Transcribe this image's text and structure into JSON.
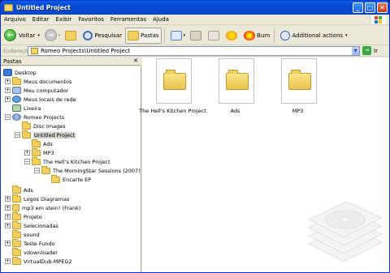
{
  "window": {
    "title": "Untitled Project"
  },
  "menu": [
    "Arquivo",
    "Editar",
    "Exibir",
    "Favoritos",
    "Ferramentas",
    "Ajuda"
  ],
  "toolbar": {
    "back": "Voltar",
    "search": "Pesquisar",
    "folders": "Pastas",
    "burn": "Burn",
    "additional": "Additional actions"
  },
  "address": {
    "label": "Endereço",
    "value": "Romeo Projects\\Untitled Project",
    "go": "Ir"
  },
  "pane": {
    "title": "Pastas"
  },
  "tree": [
    {
      "label": "Desktop"
    },
    {
      "label": "Meus documentos"
    },
    {
      "label": "Meu computador"
    },
    {
      "label": "Meus locais de rede"
    },
    {
      "label": "Lixeira"
    },
    {
      "label": "Romeo Projects"
    },
    {
      "label": "Disc Images"
    },
    {
      "label": "Untitled Project"
    },
    {
      "label": "Ads"
    },
    {
      "label": "MP3"
    },
    {
      "label": "The Hell's Kitchen Project"
    },
    {
      "label": "The MorningStar Sessions (2007)"
    },
    {
      "label": "Encarte EP"
    },
    {
      "label": "Ads"
    },
    {
      "label": "Logos Diagramas"
    },
    {
      "label": "mp3 em stein! (Frank)"
    },
    {
      "label": "Projeto"
    },
    {
      "label": "Selecionadas"
    },
    {
      "label": "sound"
    },
    {
      "label": "Teste Fundo"
    },
    {
      "label": "vdownloader"
    },
    {
      "label": "VirtualDub-MPEG2"
    }
  ],
  "files": [
    {
      "label": "The Hell's Kitchen Project"
    },
    {
      "label": "Ads"
    },
    {
      "label": "MP3"
    }
  ]
}
